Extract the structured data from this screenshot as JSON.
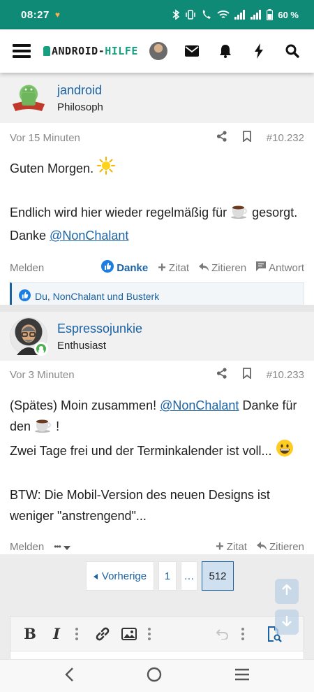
{
  "status": {
    "time": "08:27",
    "battery": "60 %"
  },
  "header": {
    "logo_prefix": "ANDROID-",
    "logo_suffix": "HILFE"
  },
  "posts": [
    {
      "username": "jandroid",
      "user_title": "Philosoph",
      "timestamp": "Vor 15 Minuten",
      "post_number": "#10.232",
      "body": {
        "line1": "Guten Morgen.",
        "line2_a": "Endlich wird hier wieder regelmäßig für",
        "line2_b": "gesorgt.",
        "line3_a": "Danke",
        "mention": "@NonChalant"
      },
      "actions": {
        "report": "Melden",
        "like": "Danke",
        "quote_add": "Zitat",
        "quote": "Zitieren",
        "reply": "Antwort"
      },
      "reactions": "Du, NonChalant und Busterk"
    },
    {
      "username": "Espressojunkie",
      "user_title": "Enthusiast",
      "timestamp": "Vor 3 Minuten",
      "post_number": "#10.233",
      "body": {
        "line1_a": "(Spätes) Moin zusammen!",
        "mention": "@NonChalant",
        "line1_b": "Danke für",
        "line2_a": "den",
        "line2_b": "!",
        "line3": "Zwei Tage frei und der Terminkalender ist voll...",
        "line4": "BTW: Die Mobil-Version des neuen Designs ist",
        "line5": "weniger \"anstrengend\"..."
      },
      "actions": {
        "report": "Melden",
        "more": "•••",
        "quote_add": "Zitat",
        "quote": "Zitieren"
      }
    }
  ],
  "pagination": {
    "prev": "Vorherige",
    "page1": "1",
    "dots": "…",
    "current": "512"
  },
  "editor": {
    "bold": "B",
    "italic": "I"
  },
  "colors": {
    "accent": "#1b62a3",
    "status_bar": "#0f8a76",
    "brand_green": "#16a07f"
  },
  "icons": [
    "menu-icon",
    "mail-icon",
    "bell-icon",
    "bolt-icon",
    "search-icon",
    "share-icon",
    "bookmark-icon",
    "like-icon",
    "plus-icon",
    "reply-icon",
    "comment-icon",
    "link-icon",
    "image-icon",
    "undo-icon",
    "preview-icon",
    "back-icon",
    "home-icon",
    "recents-icon"
  ]
}
